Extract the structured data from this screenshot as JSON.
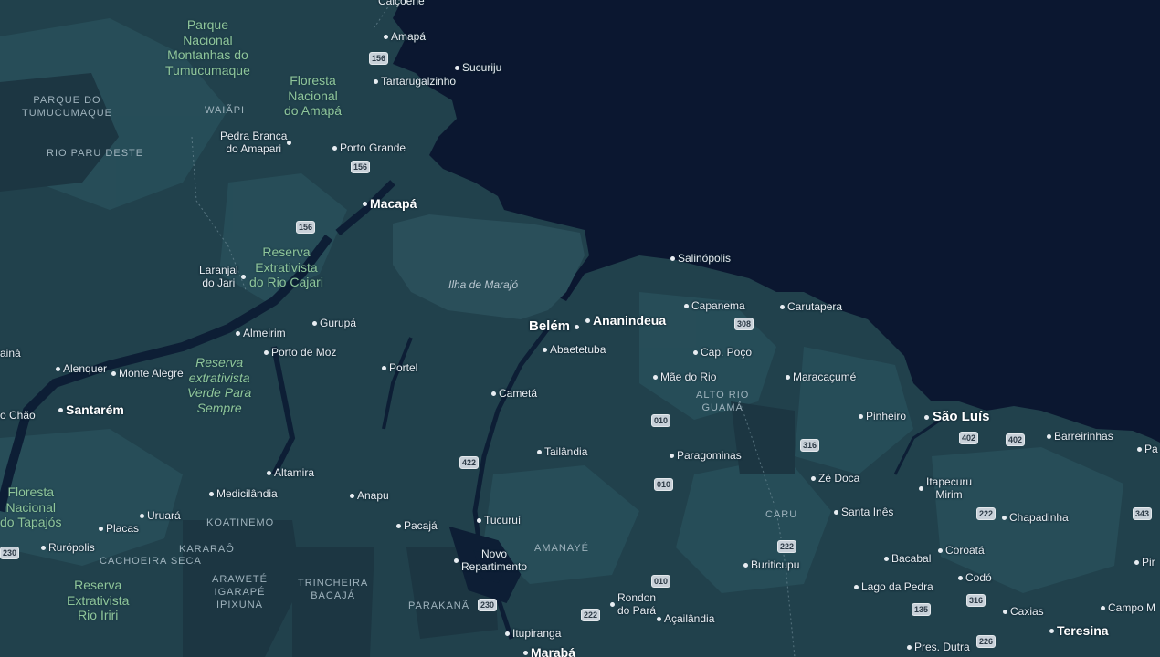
{
  "map": {
    "water_color": "#0b1730",
    "land_color": "#21414c",
    "forest_color": "#28505b",
    "cities": [
      {
        "name": "Calçoene",
        "size": "small"
      },
      {
        "name": "Amapá",
        "size": "small"
      },
      {
        "name": "Sucuriju",
        "size": "small"
      },
      {
        "name": "Tartarugalzinho",
        "size": "small"
      },
      {
        "name": "Porto Grande",
        "size": "small"
      },
      {
        "name": "Pedra Branca\ndo Amapari",
        "size": "small"
      },
      {
        "name": "Macapá",
        "size": "major"
      },
      {
        "name": "Laranjal\ndo Jari",
        "size": "small"
      },
      {
        "name": "Salinópolis",
        "size": "small"
      },
      {
        "name": "Capanema",
        "size": "small"
      },
      {
        "name": "Carutapera",
        "size": "small"
      },
      {
        "name": "Belém",
        "size": "large"
      },
      {
        "name": "Ananindeua",
        "size": "major"
      },
      {
        "name": "Gurupá",
        "size": "small"
      },
      {
        "name": "Almeirim",
        "size": "small"
      },
      {
        "name": "Porto de Moz",
        "size": "small"
      },
      {
        "name": "Abaetetuba",
        "size": "small"
      },
      {
        "name": "Cap. Poço",
        "size": "small"
      },
      {
        "name": "Portel",
        "size": "small"
      },
      {
        "name": "Mãe do Rio",
        "size": "small"
      },
      {
        "name": "Maracaçumé",
        "size": "small"
      },
      {
        "name": "ainá",
        "size": "small"
      },
      {
        "name": "Alenquer",
        "size": "small"
      },
      {
        "name": "Monte Alegre",
        "size": "small"
      },
      {
        "name": "Cametá",
        "size": "small"
      },
      {
        "name": "o Chão",
        "size": "small"
      },
      {
        "name": "Santarém",
        "size": "major"
      },
      {
        "name": "Pinheiro",
        "size": "small"
      },
      {
        "name": "São Luís",
        "size": "large"
      },
      {
        "name": "Barreirinhas",
        "size": "small"
      },
      {
        "name": "Pa",
        "size": "small"
      },
      {
        "name": "Tailândia",
        "size": "small"
      },
      {
        "name": "Paragominas",
        "size": "small"
      },
      {
        "name": "Altamira",
        "size": "small"
      },
      {
        "name": "Zé Doca",
        "size": "small"
      },
      {
        "name": "Itapecuru\nMirim",
        "size": "small"
      },
      {
        "name": "Medicilândia",
        "size": "small"
      },
      {
        "name": "Anapu",
        "size": "small"
      },
      {
        "name": "Santa Inês",
        "size": "small"
      },
      {
        "name": "Uruará",
        "size": "small"
      },
      {
        "name": "Chapadinha",
        "size": "small"
      },
      {
        "name": "Placas",
        "size": "small"
      },
      {
        "name": "Pacajá",
        "size": "small"
      },
      {
        "name": "Tucuruí",
        "size": "small"
      },
      {
        "name": "Rurópolis",
        "size": "small"
      },
      {
        "name": "Bacabal",
        "size": "small"
      },
      {
        "name": "Coroatá",
        "size": "small"
      },
      {
        "name": "Novo\nRepartimento",
        "size": "small"
      },
      {
        "name": "Buriticupu",
        "size": "small"
      },
      {
        "name": "Pir",
        "size": "small"
      },
      {
        "name": "Codó",
        "size": "small"
      },
      {
        "name": "Lago da Pedra",
        "size": "small"
      },
      {
        "name": "Rondon\ndo Pará",
        "size": "small"
      },
      {
        "name": "Caxias",
        "size": "small"
      },
      {
        "name": "Campo M",
        "size": "small"
      },
      {
        "name": "Açailândia",
        "size": "small"
      },
      {
        "name": "Itupiranga",
        "size": "small"
      },
      {
        "name": "Teresina",
        "size": "major"
      },
      {
        "name": "Pres. Dutra",
        "size": "small"
      },
      {
        "name": "Marabá",
        "size": "major"
      }
    ],
    "parks": [
      {
        "name": "Parque\nNacional\nMontanhas do\nTumucumaque",
        "italic": false
      },
      {
        "name": "Floresta\nNacional\ndo Amapá",
        "italic": false
      },
      {
        "name": "Reserva\nExtrativista\ndo Rio Cajari",
        "italic": false
      },
      {
        "name": "Reserva\nextrativista\nVerde Para\nSempre",
        "italic": true
      },
      {
        "name": "Floresta\nNacional\ndo Tapajós",
        "italic": false
      },
      {
        "name": "Reserva\nExtrativista\nRio Iriri",
        "italic": false
      }
    ],
    "territories": [
      "PARQUE DO\nTUMUCUMAQUE",
      "WAIÃPI",
      "RIO PARU DESTE",
      "ALTO RIO\nGUAMÁ",
      "KOATINEMO",
      "CARU",
      "CACHOEIRA SECA",
      "KARARAÔ",
      "AMANAYÉ",
      "ARAWETÉ\nIGARAPÉ\nIPIXUNA",
      "TRINCHEIRA\nBACAJÁ",
      "PARAKANÃ"
    ],
    "islands": [
      "Ilha de Marajó"
    ],
    "roads": [
      "156",
      "156",
      "156",
      "308",
      "010",
      "010",
      "316",
      "402",
      "402",
      "422",
      "222",
      "343",
      "230",
      "222",
      "010",
      "230",
      "222",
      "135",
      "316",
      "226"
    ]
  }
}
